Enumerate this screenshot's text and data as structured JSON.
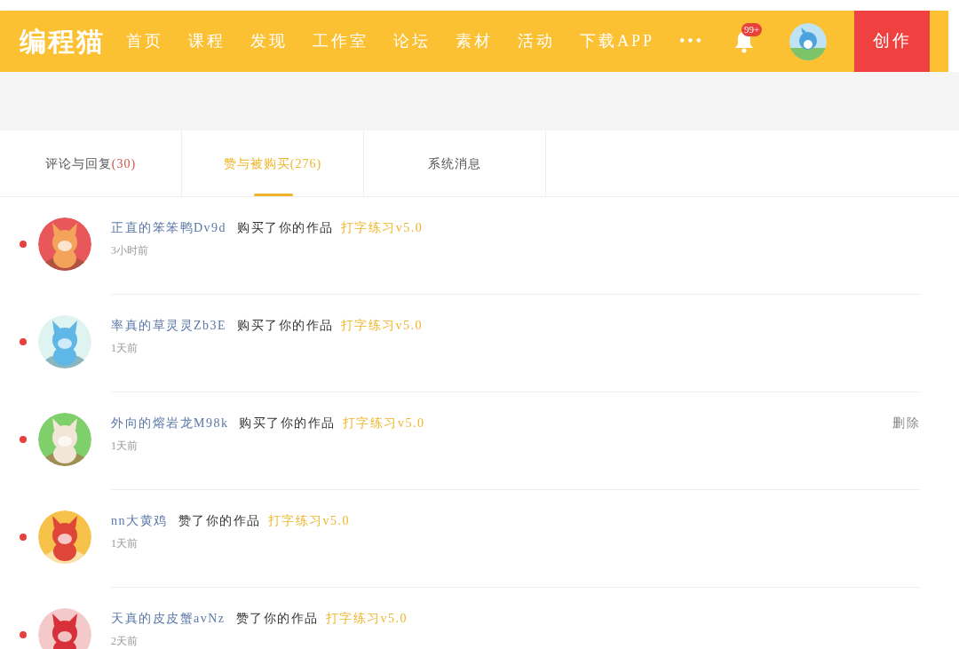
{
  "header": {
    "logo": "编程猫",
    "nav": [
      {
        "label": "首页"
      },
      {
        "label": "课程"
      },
      {
        "label": "发现"
      },
      {
        "label": "工作室"
      },
      {
        "label": "论坛"
      },
      {
        "label": "素材"
      },
      {
        "label": "活动"
      },
      {
        "label": "下载APP"
      },
      {
        "label": "•••"
      }
    ],
    "notification_badge": "99+",
    "create_button": "创作"
  },
  "tabs": [
    {
      "label": "评论与回复",
      "count": "(30)",
      "selected": false
    },
    {
      "label": "赞与被购买",
      "count": "(276)",
      "selected": true
    },
    {
      "label": "系统消息",
      "selected": false
    }
  ],
  "messages": [
    {
      "user": "正直的笨笨鸭Dv9d",
      "action": "购买了你的作品",
      "work": "打字练习v5.0",
      "time": "3小时前",
      "unread": true
    },
    {
      "user": "率真的草灵灵Zb3E",
      "action": "购买了你的作品",
      "work": "打字练习v5.0",
      "time": "1天前",
      "unread": true
    },
    {
      "user": "外向的熔岩龙M98k",
      "action": "购买了你的作品",
      "work": "打字练习v5.0",
      "time": "1天前",
      "unread": true,
      "delete": "删除"
    },
    {
      "user": "nn大黄鸡",
      "action": "赞了你的作品",
      "work": "打字练习v5.0",
      "time": "1天前",
      "unread": true
    },
    {
      "user": "天真的皮皮蟹avNz",
      "action": "赞了你的作品",
      "work": "打字练习v5.0",
      "time": "2天前",
      "unread": true
    }
  ]
}
